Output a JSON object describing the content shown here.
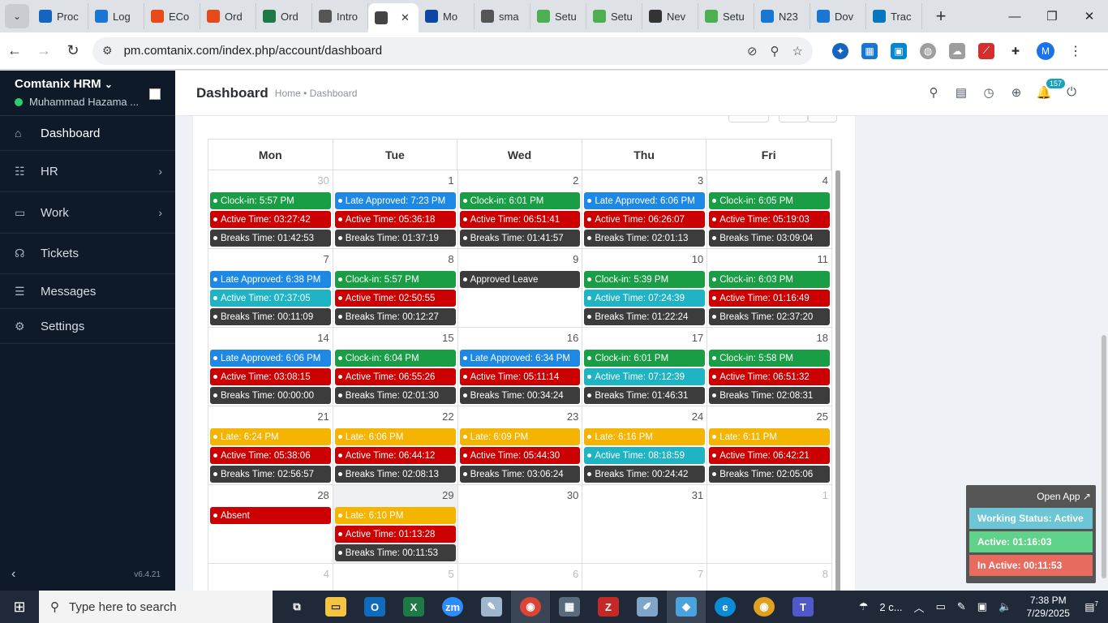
{
  "browser": {
    "tabs": [
      "Proc",
      "Log",
      "ECo",
      "Ord",
      "Ord",
      "Intro",
      "",
      "Mo",
      "sma",
      "Setu",
      "Setu",
      "Nev",
      "Setu",
      "N23",
      "Dov",
      "Trac"
    ],
    "url": "pm.comtanix.com/index.php/account/dashboard",
    "avatar_letter": "M"
  },
  "sidebar": {
    "brand": "Comtanix HRM",
    "user": "Muhammad Hazama ...",
    "items": [
      {
        "label": "Dashboard",
        "icon": "home-icon"
      },
      {
        "label": "HR",
        "icon": "users-icon"
      },
      {
        "label": "Work",
        "icon": "briefcase-icon"
      },
      {
        "label": "Tickets",
        "icon": "headset-icon"
      },
      {
        "label": "Messages",
        "icon": "message-icon"
      },
      {
        "label": "Settings",
        "icon": "gear-icon"
      }
    ],
    "version": "v6.4.21"
  },
  "header": {
    "title": "Dashboard",
    "breadcrumb": "Home • Dashboard",
    "notification_count": "157"
  },
  "calendar": {
    "weekdays": [
      "Mon",
      "Tue",
      "Wed",
      "Thu",
      "Fri"
    ],
    "colors": {
      "green": "#1a9e45",
      "blue": "#1e88e5",
      "red": "#cc0000",
      "dark": "#3c3c3c",
      "teal": "#1fb4c4",
      "yellow": "#f5b400"
    },
    "weeks": [
      [
        {
          "day": "30",
          "other": true,
          "events": [
            {
              "c": "green",
              "t": "Clock-in: 5:57 PM"
            },
            {
              "c": "red",
              "t": "Active Time: 03:27:42"
            },
            {
              "c": "dark",
              "t": "Breaks Time: 01:42:53"
            }
          ]
        },
        {
          "day": "1",
          "events": [
            {
              "c": "blue",
              "t": "Late Approved: 7:23 PM"
            },
            {
              "c": "red",
              "t": "Active Time: 05:36:18"
            },
            {
              "c": "dark",
              "t": "Breaks Time: 01:37:19"
            }
          ]
        },
        {
          "day": "2",
          "events": [
            {
              "c": "green",
              "t": "Clock-in: 6:01 PM"
            },
            {
              "c": "red",
              "t": "Active Time: 06:51:41"
            },
            {
              "c": "dark",
              "t": "Breaks Time: 01:41:57"
            }
          ]
        },
        {
          "day": "3",
          "events": [
            {
              "c": "blue",
              "t": "Late Approved: 6:06 PM"
            },
            {
              "c": "red",
              "t": "Active Time: 06:26:07"
            },
            {
              "c": "dark",
              "t": "Breaks Time: 02:01:13"
            }
          ]
        },
        {
          "day": "4",
          "events": [
            {
              "c": "green",
              "t": "Clock-in: 6:05 PM"
            },
            {
              "c": "red",
              "t": "Active Time: 05:19:03"
            },
            {
              "c": "dark",
              "t": "Breaks Time: 03:09:04"
            }
          ]
        }
      ],
      [
        {
          "day": "7",
          "events": [
            {
              "c": "blue",
              "t": "Late Approved: 6:38 PM"
            },
            {
              "c": "teal",
              "t": "Active Time: 07:37:05"
            },
            {
              "c": "dark",
              "t": "Breaks Time: 00:11:09"
            }
          ]
        },
        {
          "day": "8",
          "events": [
            {
              "c": "green",
              "t": "Clock-in: 5:57 PM"
            },
            {
              "c": "red",
              "t": "Active Time: 02:50:55"
            },
            {
              "c": "dark",
              "t": "Breaks Time: 00:12:27"
            }
          ]
        },
        {
          "day": "9",
          "events": [
            {
              "c": "dark",
              "t": "Approved Leave"
            }
          ]
        },
        {
          "day": "10",
          "events": [
            {
              "c": "green",
              "t": "Clock-in: 5:39 PM"
            },
            {
              "c": "teal",
              "t": "Active Time: 07:24:39"
            },
            {
              "c": "dark",
              "t": "Breaks Time: 01:22:24"
            }
          ]
        },
        {
          "day": "11",
          "events": [
            {
              "c": "green",
              "t": "Clock-in: 6:03 PM"
            },
            {
              "c": "red",
              "t": "Active Time: 01:16:49"
            },
            {
              "c": "dark",
              "t": "Breaks Time: 02:37:20"
            }
          ]
        }
      ],
      [
        {
          "day": "14",
          "events": [
            {
              "c": "blue",
              "t": "Late Approved: 6:06 PM"
            },
            {
              "c": "red",
              "t": "Active Time: 03:08:15"
            },
            {
              "c": "dark",
              "t": "Breaks Time: 00:00:00"
            }
          ]
        },
        {
          "day": "15",
          "events": [
            {
              "c": "green",
              "t": "Clock-in: 6:04 PM"
            },
            {
              "c": "red",
              "t": "Active Time: 06:55:26"
            },
            {
              "c": "dark",
              "t": "Breaks Time: 02:01:30"
            }
          ]
        },
        {
          "day": "16",
          "events": [
            {
              "c": "blue",
              "t": "Late Approved: 6:34 PM"
            },
            {
              "c": "red",
              "t": "Active Time: 05:11:14"
            },
            {
              "c": "dark",
              "t": "Breaks Time: 00:34:24"
            }
          ]
        },
        {
          "day": "17",
          "events": [
            {
              "c": "green",
              "t": "Clock-in: 6:01 PM"
            },
            {
              "c": "teal",
              "t": "Active Time: 07:12:39"
            },
            {
              "c": "dark",
              "t": "Breaks Time: 01:46:31"
            }
          ]
        },
        {
          "day": "18",
          "events": [
            {
              "c": "green",
              "t": "Clock-in: 5:58 PM"
            },
            {
              "c": "red",
              "t": "Active Time: 06:51:32"
            },
            {
              "c": "dark",
              "t": "Breaks Time: 02:08:31"
            }
          ]
        }
      ],
      [
        {
          "day": "21",
          "events": [
            {
              "c": "yellow",
              "t": "Late: 6:24 PM"
            },
            {
              "c": "red",
              "t": "Active Time: 05:38:06"
            },
            {
              "c": "dark",
              "t": "Breaks Time: 02:56:57"
            }
          ]
        },
        {
          "day": "22",
          "events": [
            {
              "c": "yellow",
              "t": "Late: 6:06 PM"
            },
            {
              "c": "red",
              "t": "Active Time: 06:44:12"
            },
            {
              "c": "dark",
              "t": "Breaks Time: 02:08:13"
            }
          ]
        },
        {
          "day": "23",
          "events": [
            {
              "c": "yellow",
              "t": "Late: 6:09 PM"
            },
            {
              "c": "red",
              "t": "Active Time: 05:44:30"
            },
            {
              "c": "dark",
              "t": "Breaks Time: 03:06:24"
            }
          ]
        },
        {
          "day": "24",
          "events": [
            {
              "c": "yellow",
              "t": "Late: 6:16 PM"
            },
            {
              "c": "teal",
              "t": "Active Time: 08:18:59"
            },
            {
              "c": "dark",
              "t": "Breaks Time: 00:24:42"
            }
          ]
        },
        {
          "day": "25",
          "events": [
            {
              "c": "yellow",
              "t": "Late: 6:11 PM"
            },
            {
              "c": "red",
              "t": "Active Time: 06:42:21"
            },
            {
              "c": "dark",
              "t": "Breaks Time: 02:05:06"
            }
          ]
        }
      ],
      [
        {
          "day": "28",
          "events": [
            {
              "c": "red",
              "t": "Absent"
            }
          ]
        },
        {
          "day": "29",
          "today": true,
          "events": [
            {
              "c": "yellow",
              "t": "Late: 6:10 PM"
            },
            {
              "c": "red",
              "t": "Active Time: 01:13:28"
            },
            {
              "c": "dark",
              "t": "Breaks Time: 00:11:53"
            }
          ]
        },
        {
          "day": "30",
          "events": []
        },
        {
          "day": "31",
          "events": []
        },
        {
          "day": "1",
          "other": true,
          "events": []
        }
      ],
      [
        {
          "day": "4",
          "other": true,
          "events": []
        },
        {
          "day": "5",
          "other": true,
          "events": []
        },
        {
          "day": "6",
          "other": true,
          "events": []
        },
        {
          "day": "7",
          "other": true,
          "events": []
        },
        {
          "day": "8",
          "other": true,
          "events": []
        }
      ]
    ]
  },
  "status_widget": {
    "open_app": "Open App ↗",
    "working_status": "Working Status: Active",
    "active": "Active: 01:16:03",
    "inactive": "In Active: 00:11:53",
    "colors": {
      "status": "#6cc6d6",
      "active": "#5fd38a",
      "inactive": "#e86b5f"
    }
  },
  "taskbar": {
    "search_placeholder": "Type here to search",
    "weather": "2 c...",
    "time": "7:38 PM",
    "date": "7/29/2025",
    "notif_count": "7"
  }
}
